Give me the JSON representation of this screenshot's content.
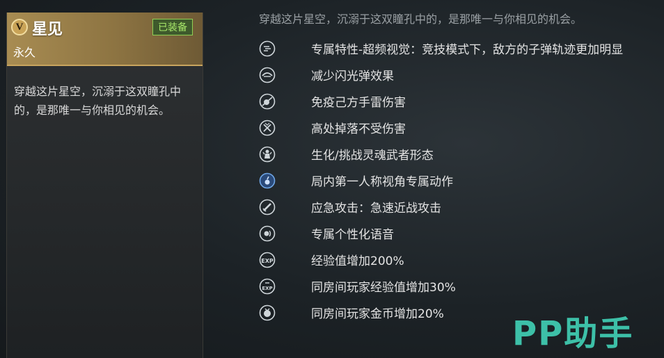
{
  "card": {
    "vip_letter": "V",
    "title": "星见",
    "subtitle": "永久",
    "equip_badge": "已装备",
    "description": "穿越这片星空，沉溺于这双瞳孔中的，是那唯一与你相见的机会。"
  },
  "headline": "穿越这片星空，沉溺于这双瞳孔中的，是那唯一与你相见的机会。",
  "features": [
    {
      "icon": "vision-icon",
      "label": "专属特性-超频视觉：竞技模式下，敌方的子弹轨迹更加明显"
    },
    {
      "icon": "eye-shield-icon",
      "label": "减少闪光弹效果"
    },
    {
      "icon": "grenade-immune-icon",
      "label": "免疫己方手雷伤害"
    },
    {
      "icon": "fall-damage-icon",
      "label": "高处掉落不受伤害"
    },
    {
      "icon": "soul-warrior-icon",
      "label": "生化/挑战灵魂武者形态"
    },
    {
      "icon": "first-person-action-icon",
      "label": "局内第一人称视角专属动作"
    },
    {
      "icon": "melee-icon",
      "label": "应急攻击：急速近战攻击"
    },
    {
      "icon": "voice-icon",
      "label": "专属个性化语音"
    },
    {
      "icon": "exp-icon",
      "label": "经验值增加200%"
    },
    {
      "icon": "room-exp-icon",
      "label": "同房间玩家经验值增加30%"
    },
    {
      "icon": "coin-icon",
      "label": "同房间玩家金币增加20%"
    }
  ],
  "watermark": "PP助手",
  "colors": {
    "gold": "#a88c52",
    "equipped_green": "#a8e86a",
    "watermark_teal": "#3fc9b0"
  }
}
